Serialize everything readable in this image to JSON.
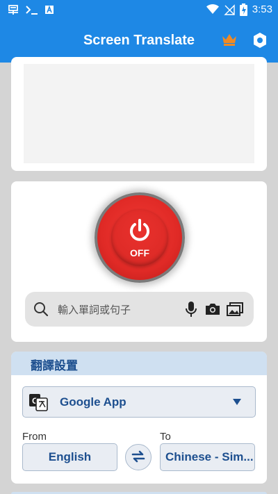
{
  "status_bar": {
    "time": "3:53",
    "left_icons": [
      "app-notification-icon",
      "terminal-icon",
      "accessibility-icon"
    ],
    "right_icons": [
      "wifi-icon",
      "no-sim-icon",
      "battery-charging-icon"
    ]
  },
  "app_bar": {
    "title": "Screen Translate",
    "actions": [
      "crown-icon",
      "settings-icon"
    ],
    "accent_color": "#1e88e5",
    "crown_color": "#f08a24"
  },
  "power": {
    "state_label": "OFF",
    "color": "#e02a26"
  },
  "search": {
    "placeholder": "輸入單詞或句子",
    "actions": [
      "mic-icon",
      "camera-icon",
      "gallery-icon"
    ]
  },
  "translation_settings": {
    "title": "翻譯設置",
    "engine": "Google App",
    "from_label": "From",
    "to_label": "To",
    "from_language": "English",
    "to_language": "Chinese - Sim..."
  }
}
